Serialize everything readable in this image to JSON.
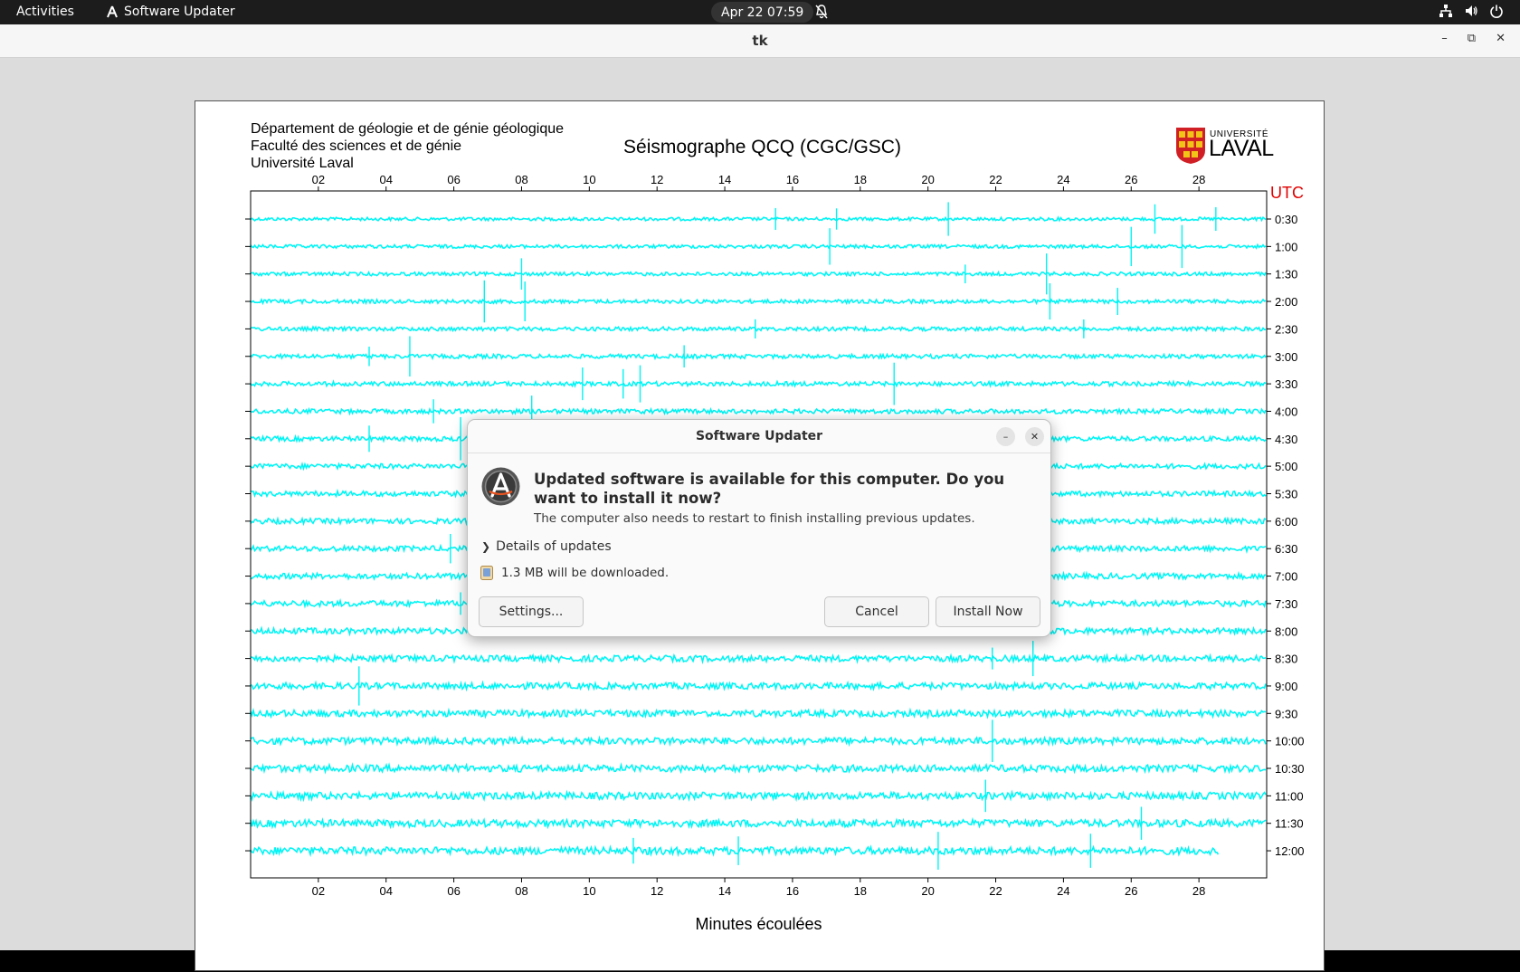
{
  "topbar": {
    "activities": "Activities",
    "app_name": "Software Updater",
    "clock": "Apr 22  07:59"
  },
  "window": {
    "title": "tk"
  },
  "figure": {
    "header_lines": [
      "Département de géologie et de génie géologique",
      "Faculté des sciences et de génie",
      "Université Laval"
    ],
    "logo_text_small": "UNIVERSITÉ",
    "logo_text_big": "LAVAL"
  },
  "chart_data": {
    "type": "line",
    "title": "Séismographe QCQ (CGC/GSC)",
    "xlabel": "Minutes écoulées",
    "xlim": [
      0,
      30
    ],
    "x_ticks": [
      "02",
      "04",
      "06",
      "08",
      "10",
      "12",
      "14",
      "16",
      "18",
      "20",
      "22",
      "24",
      "26",
      "28"
    ],
    "right_label": "UTC",
    "row_labels": [
      "0:30",
      "1:00",
      "1:30",
      "2:00",
      "2:30",
      "3:00",
      "3:30",
      "4:00",
      "4:30",
      "5:00",
      "5:30",
      "6:00",
      "6:30",
      "7:00",
      "7:30",
      "8:00",
      "8:30",
      "9:00",
      "9:30",
      "10:00",
      "10:30",
      "11:00",
      "11:30",
      "12:00"
    ],
    "trace_color": "#00f5f5",
    "last_row_end_minute": 28.6,
    "spikes": [
      [
        0,
        15.5
      ],
      [
        0,
        20.6
      ],
      [
        0,
        26.7
      ],
      [
        0,
        28.5
      ],
      [
        0,
        17.3
      ],
      [
        1,
        17.1
      ],
      [
        1,
        26.0
      ],
      [
        1,
        27.5
      ],
      [
        2,
        8.0
      ],
      [
        2,
        21.1
      ],
      [
        2,
        23.5
      ],
      [
        3,
        6.9
      ],
      [
        3,
        8.1
      ],
      [
        3,
        23.6
      ],
      [
        3,
        25.6
      ],
      [
        4,
        14.9
      ],
      [
        4,
        24.6
      ],
      [
        5,
        3.5
      ],
      [
        5,
        4.7
      ],
      [
        5,
        12.8
      ],
      [
        6,
        9.8
      ],
      [
        6,
        11.0
      ],
      [
        6,
        11.5
      ],
      [
        6,
        19.0
      ],
      [
        7,
        5.4
      ],
      [
        7,
        8.3
      ],
      [
        8,
        3.5
      ],
      [
        8,
        6.2
      ],
      [
        12,
        5.9
      ],
      [
        14,
        6.2
      ],
      [
        16,
        21.9
      ],
      [
        16,
        23.1
      ],
      [
        17,
        3.2
      ],
      [
        19,
        21.9
      ],
      [
        21,
        21.7
      ],
      [
        22,
        26.3
      ],
      [
        23,
        11.3
      ],
      [
        23,
        14.4
      ],
      [
        23,
        20.3
      ],
      [
        23,
        24.8
      ]
    ]
  },
  "dialog": {
    "title": "Software Updater",
    "headline": "Updated software is available for this computer. Do you want to install it now?",
    "subline": "The computer also needs to restart to finish installing previous updates.",
    "details_label": "Details of updates",
    "download_label": "1.3 MB will be downloaded.",
    "settings_button": "Settings...",
    "cancel_button": "Cancel",
    "install_button": "Install Now"
  }
}
